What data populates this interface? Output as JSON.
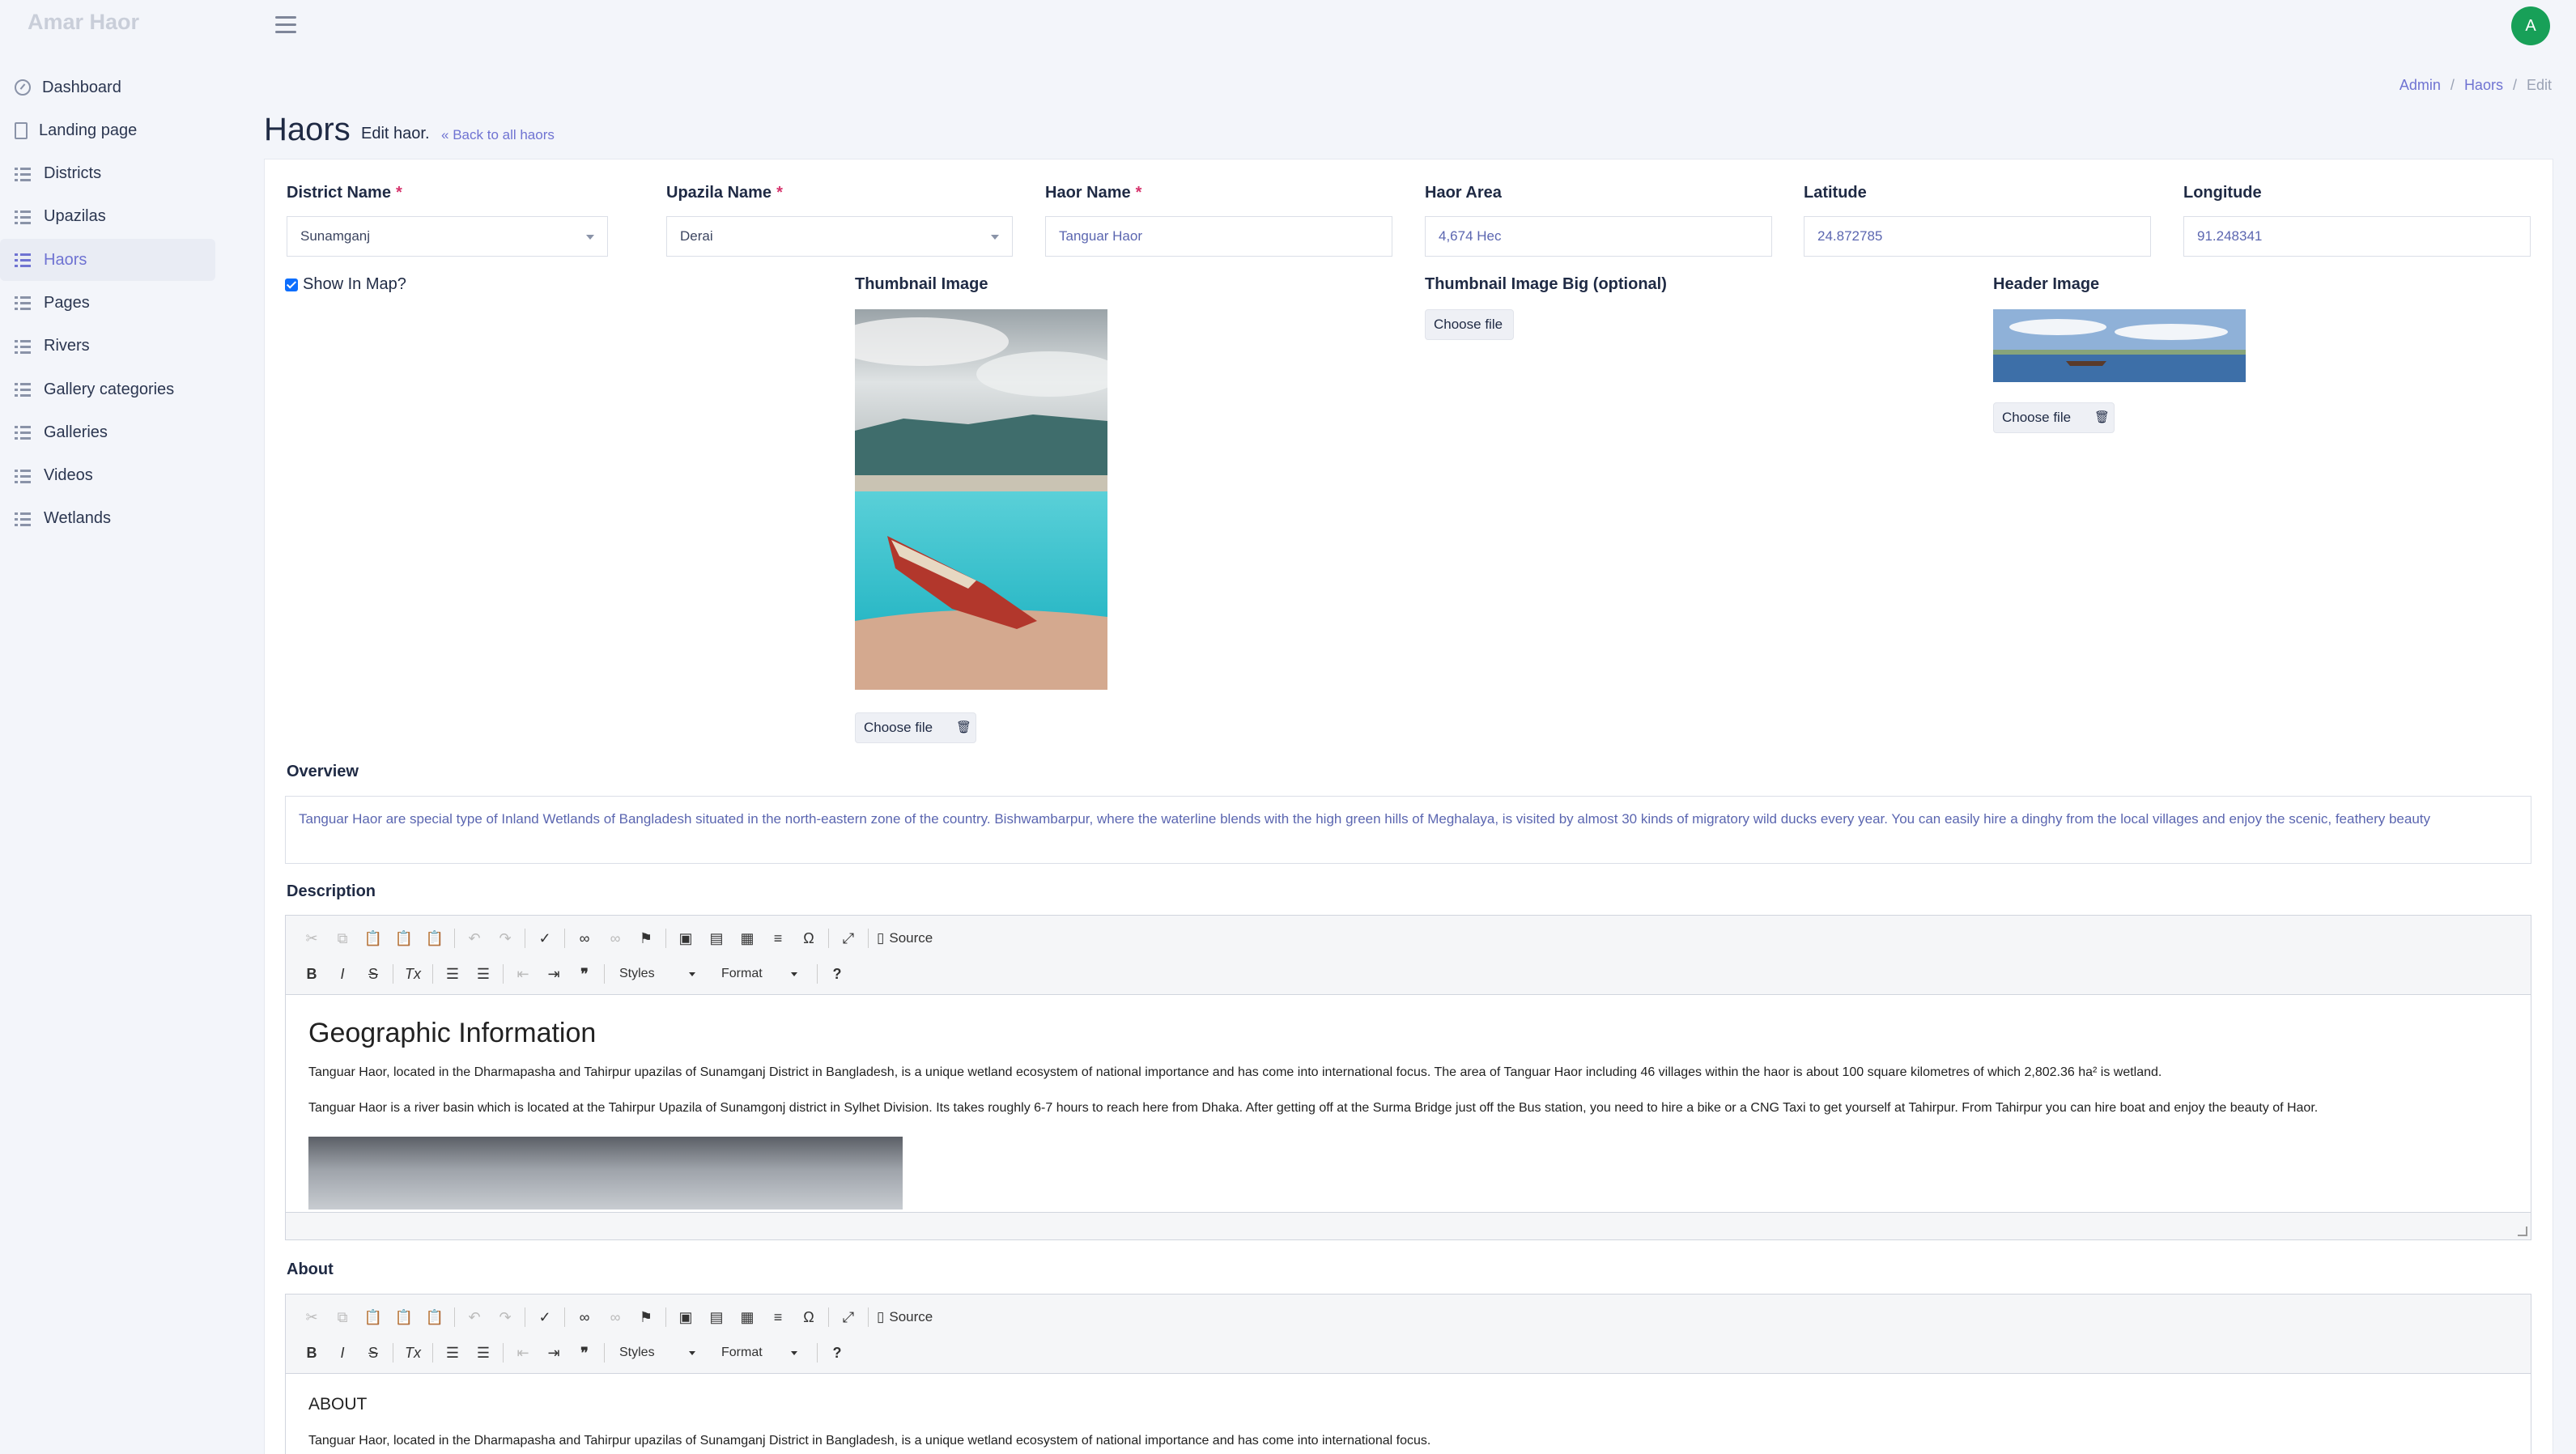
{
  "app": {
    "brand": "Amar Haor",
    "avatar_initial": "A"
  },
  "sidebar": {
    "items": [
      {
        "label": "Dashboard",
        "icon": "gauge-icon"
      },
      {
        "label": "Landing page",
        "icon": "file-icon"
      },
      {
        "label": "Districts",
        "icon": "list-icon"
      },
      {
        "label": "Upazilas",
        "icon": "list-icon"
      },
      {
        "label": "Haors",
        "icon": "list-icon",
        "active": true
      },
      {
        "label": "Pages",
        "icon": "list-icon"
      },
      {
        "label": "Rivers",
        "icon": "list-icon"
      },
      {
        "label": "Gallery categories",
        "icon": "list-icon"
      },
      {
        "label": "Galleries",
        "icon": "list-icon"
      },
      {
        "label": "Videos",
        "icon": "list-icon"
      },
      {
        "label": "Wetlands",
        "icon": "list-icon"
      }
    ]
  },
  "header": {
    "title": "Haors",
    "subtitle": "Edit haor.",
    "back_link": "Back to all haors",
    "breadcrumb": [
      "Admin",
      "Haors",
      "Edit"
    ]
  },
  "form": {
    "district": {
      "label": "District Name",
      "value": "Sunamganj"
    },
    "upazila": {
      "label": "Upazila Name",
      "value": "Derai"
    },
    "haor_name": {
      "label": "Haor Name",
      "value": "Tanguar Haor"
    },
    "haor_area": {
      "label": "Haor Area",
      "value": "4,674 Hec"
    },
    "latitude": {
      "label": "Latitude",
      "value": "24.872785"
    },
    "longitude": {
      "label": "Longitude",
      "value": "91.248341"
    },
    "required_mark": "*",
    "show_in_map": {
      "label": "Show In Map?",
      "checked": true
    },
    "thumbnail": {
      "label": "Thumbnail Image",
      "button": "Choose file"
    },
    "thumbnail_big": {
      "label": "Thumbnail Image Big (optional)",
      "button": "Choose file"
    },
    "header_image": {
      "label": "Header Image",
      "button": "Choose file"
    },
    "overview": {
      "label": "Overview",
      "value": "Tanguar Haor are special type of Inland Wetlands of Bangladesh situated in the north-eastern zone of the country. Bishwambarpur, where the waterline blends with the high green hills of Meghalaya, is visited by almost 30 kinds of migratory wild ducks every year. You can easily hire a dinghy from the local villages and enjoy the scenic, feathery beauty"
    }
  },
  "editor_toolbar": {
    "source": "Source",
    "styles": "Styles",
    "format": "Format"
  },
  "description": {
    "label": "Description",
    "heading": "Geographic Information",
    "paragraphs": [
      "Tanguar Haor, located in the Dharmapasha and Tahirpur upazilas of Sunamganj District in Bangladesh, is a unique wetland ecosystem of national importance and has come into international focus. The area of Tanguar Haor including 46 villages within the haor is about 100 square kilometres of which 2,802.36 ha² is wetland.",
      "Tanguar Haor is a river basin which is located at the Tahirpur Upazila of Sunamgonj district in Sylhet Division. Its takes roughly 6-7 hours to reach here from Dhaka. After getting off at the Surma Bridge just off the Bus station, you need to hire a bike or a CNG Taxi to get yourself at Tahirpur. From Tahirpur you can hire boat and enjoy the beauty of Haor."
    ]
  },
  "about": {
    "label": "About",
    "heading": "ABOUT",
    "paragraphs": [
      "Tanguar Haor, located in the Dharmapasha and Tahirpur upazilas of Sunamganj District in Bangladesh, is a unique wetland ecosystem of national importance and has come into international focus."
    ]
  },
  "colors": {
    "accent": "#6f73d2",
    "avatar": "#18a058",
    "link": "#5b66b0"
  }
}
